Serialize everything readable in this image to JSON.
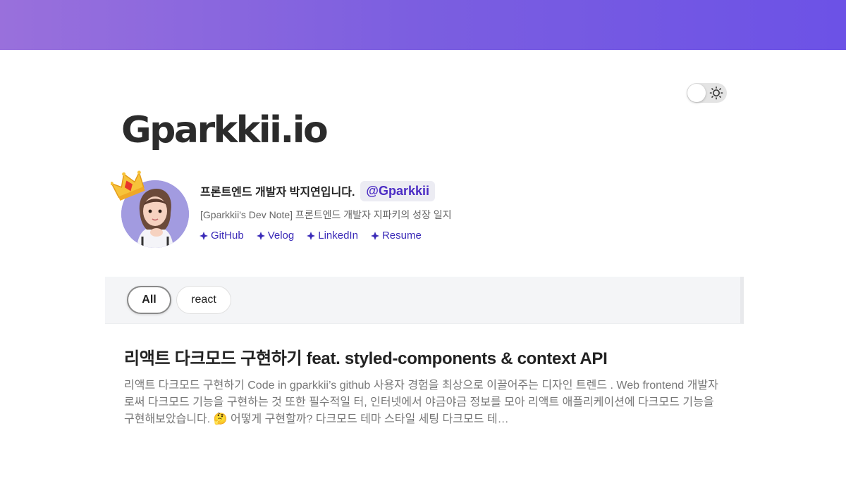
{
  "site": {
    "title": "Gparkkii.io"
  },
  "theme_toggle": {
    "icon": "sun-icon",
    "state": "light"
  },
  "profile": {
    "bio": "프론트엔드 개발자 박지연입니다.",
    "handle": "@Gparkkii",
    "subtitle": "[Gparkkii's Dev Note] 프론트엔드 개발자 지파키의 성장 일지",
    "links": [
      {
        "label": "GitHub",
        "icon": "clover-icon"
      },
      {
        "label": "Velog",
        "icon": "clover-icon"
      },
      {
        "label": "LinkedIn",
        "icon": "clover-icon"
      },
      {
        "label": "Resume",
        "icon": "clover-icon"
      }
    ]
  },
  "tags": [
    "All",
    "react"
  ],
  "selected_tag": "All",
  "posts": [
    {
      "title": "리액트 다크모드 구현하기 feat. styled-components & context API",
      "excerpt": "리액트 다크모드 구현하기 Code in gparkkii’s github 사용자 경험을 최상으로 이끌어주는 디자인 트렌드 . Web frontend 개발자로써 다크모드 기능을 구현하는 것 또한 필수적일 터, 인터넷에서 야금야금 정보를 모아 리액트 애플리케이션에 다크모드 기능을 구현해보았습니다. 🤔 어떻게 구현할까? 다크모드 테마 스타일 세팅 다크모드 테…"
    }
  ],
  "colors": {
    "header_gradient_start": "#9970dc",
    "header_gradient_end": "#6c52e6",
    "link": "#3b2bb8",
    "handle": "#4b2cc4"
  }
}
